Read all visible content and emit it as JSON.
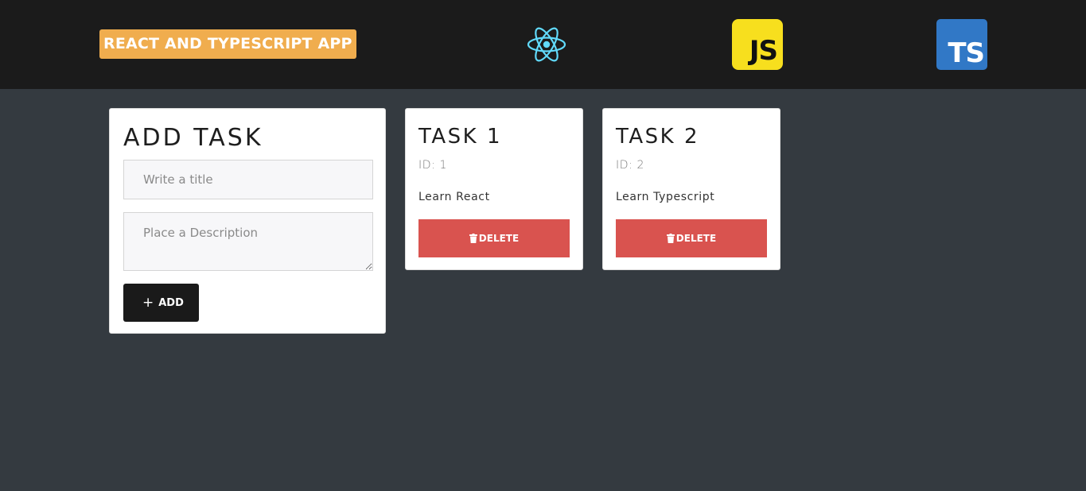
{
  "navbar": {
    "brand": "REACT AND TYPESCRIPT APP",
    "logos": [
      {
        "name": "react-logo-icon",
        "color": "#61dafb"
      },
      {
        "name": "javascript-logo-icon",
        "label": "JS",
        "color": "#f7df1e"
      },
      {
        "name": "typescript-logo-icon",
        "label": "TS",
        "color": "#3178c6"
      }
    ]
  },
  "add_task": {
    "title": "ADD TASK",
    "title_placeholder": "Write a title",
    "description_placeholder": "Place a Description",
    "add_icon": "+",
    "add_label": "ADD"
  },
  "tasks": [
    {
      "title": "TASK 1",
      "id_label": "ID: 1",
      "description": "Learn React",
      "delete_label": "DELETE"
    },
    {
      "title": "TASK 2",
      "id_label": "ID: 2",
      "description": "Learn Typescript",
      "delete_label": "DELETE"
    }
  ],
  "colors": {
    "navbar_bg": "#1b1b1b",
    "page_bg": "#343a40",
    "brand_bg": "#f0ad4e",
    "delete_bg": "#d9534f",
    "add_bg": "#1a1a1a"
  }
}
